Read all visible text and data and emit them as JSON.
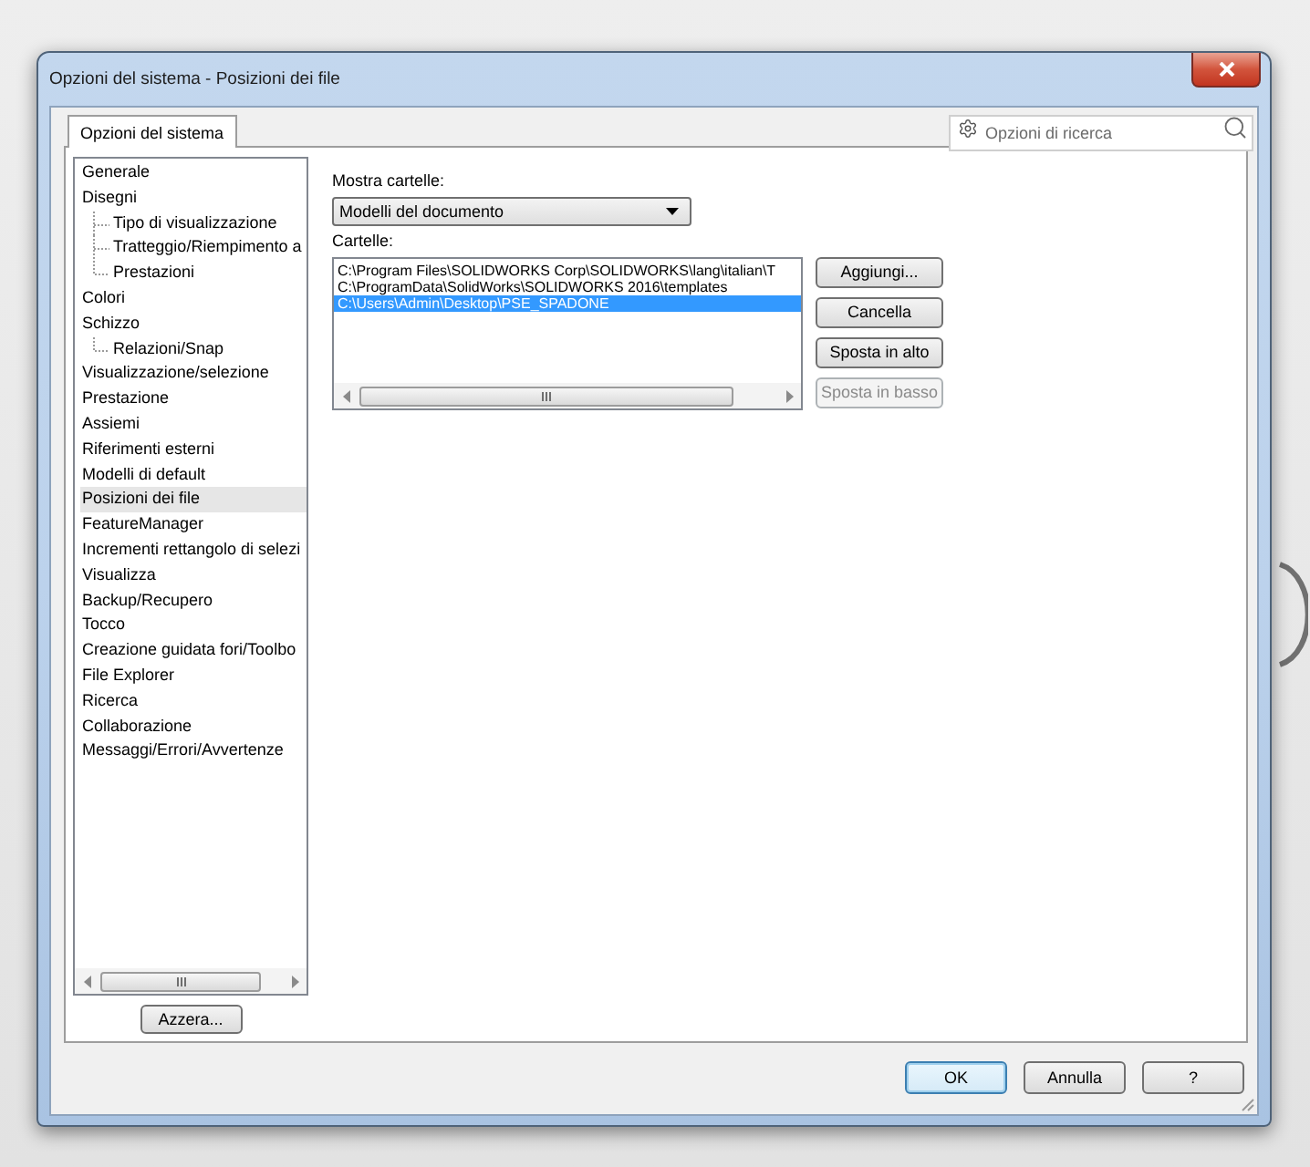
{
  "window": {
    "title": "Opzioni del sistema - Posizioni dei file"
  },
  "tabs": [
    {
      "label": "Opzioni del sistema",
      "selected": true
    }
  ],
  "search": {
    "placeholder": "Opzioni di ricerca"
  },
  "tree": {
    "items": [
      {
        "label": "Generale",
        "selected": false
      },
      {
        "label": "Disegni",
        "selected": false,
        "children": [
          {
            "label": "Tipo di visualizzazione",
            "selected": false
          },
          {
            "label": "Tratteggio/Riempimento a",
            "selected": false
          },
          {
            "label": "Prestazioni",
            "selected": false
          }
        ]
      },
      {
        "label": "Colori",
        "selected": false
      },
      {
        "label": "Schizzo",
        "selected": false,
        "children": [
          {
            "label": "Relazioni/Snap",
            "selected": false
          }
        ]
      },
      {
        "label": "Visualizzazione/selezione",
        "selected": false
      },
      {
        "label": "Prestazione",
        "selected": false
      },
      {
        "label": "Assiemi",
        "selected": false
      },
      {
        "label": "Riferimenti esterni",
        "selected": false
      },
      {
        "label": "Modelli di default",
        "selected": false
      },
      {
        "label": "Posizioni dei file",
        "selected": true
      },
      {
        "label": "FeatureManager",
        "selected": false
      },
      {
        "label": "Incrementi rettangolo di selezi",
        "selected": false
      },
      {
        "label": "Visualizza",
        "selected": false
      },
      {
        "label": "Backup/Recupero",
        "selected": false
      },
      {
        "label": "Tocco",
        "selected": false
      },
      {
        "label": "Creazione guidata fori/Toolbo",
        "selected": false
      },
      {
        "label": "File Explorer",
        "selected": false
      },
      {
        "label": "Ricerca",
        "selected": false
      },
      {
        "label": "Collaborazione",
        "selected": false
      },
      {
        "label": "Messaggi/Errori/Avvertenze",
        "selected": false
      }
    ]
  },
  "reset_button": {
    "label": "Azzera..."
  },
  "folders": {
    "show_label": "Mostra cartelle:",
    "dropdown": {
      "value": "Modelli del documento"
    },
    "list_label": "Cartelle:",
    "rows": [
      {
        "path": "C:\\Program Files\\SOLIDWORKS Corp\\SOLIDWORKS\\lang\\italian\\T",
        "selected": false
      },
      {
        "path": "C:\\ProgramData\\SolidWorks\\SOLIDWORKS 2016\\templates",
        "selected": false
      },
      {
        "path": "C:\\Users\\Admin\\Desktop\\PSE_SPADONE",
        "selected": true
      }
    ]
  },
  "side_buttons": [
    {
      "label": "Aggiungi...",
      "disabled": false
    },
    {
      "label": "Cancella",
      "disabled": false
    },
    {
      "label": "Sposta in alto",
      "disabled": false
    },
    {
      "label": "Sposta in basso",
      "disabled": true
    }
  ],
  "footer_buttons": [
    {
      "label": "OK",
      "default": true
    },
    {
      "label": "Annulla",
      "default": false
    },
    {
      "label": "?",
      "default": false
    }
  ]
}
